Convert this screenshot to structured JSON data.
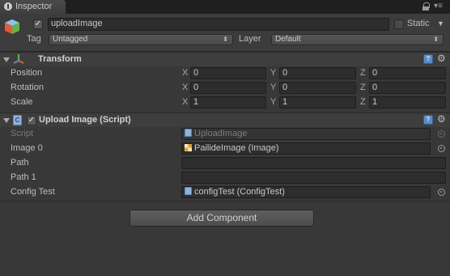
{
  "tab": {
    "label": "Inspector"
  },
  "header": {
    "object_name": "uploadImage",
    "static_label": "Static",
    "tag_label": "Tag",
    "tag_value": "Untagged",
    "layer_label": "Layer",
    "layer_value": "Default"
  },
  "transform": {
    "title": "Transform",
    "rows": [
      {
        "label": "Position",
        "x": "0",
        "y": "0",
        "z": "0"
      },
      {
        "label": "Rotation",
        "x": "0",
        "y": "0",
        "z": "0"
      },
      {
        "label": "Scale",
        "x": "1",
        "y": "1",
        "z": "1"
      }
    ],
    "axes": {
      "x": "X",
      "y": "Y",
      "z": "Z"
    }
  },
  "script_component": {
    "title": "Upload Image (Script)",
    "fields": [
      {
        "label": "Script",
        "value": "UploadImage"
      },
      {
        "label": "Image 0",
        "value": "PailideImage (Image)"
      },
      {
        "label": "Path",
        "value": ""
      },
      {
        "label": "Path 1",
        "value": ""
      },
      {
        "label": "Config Test",
        "value": "configTest (ConfigTest)"
      }
    ]
  },
  "add_component": {
    "label": "Add Component"
  },
  "icons": {
    "tab": "info-icon",
    "lock": "lock-icon",
    "menu": "menu-icon",
    "gameobject": "cube-icon",
    "transform": "transform-axes-icon",
    "script": "script-icon",
    "help": "help-icon",
    "settings": "gear-icon",
    "picker": "object-picker-icon",
    "image": "image-icon"
  },
  "colors": {
    "background": "#383838",
    "field": "#2d2d2d",
    "help": "#5b8bc8"
  }
}
